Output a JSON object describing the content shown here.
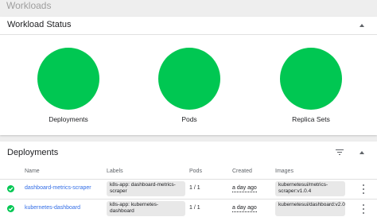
{
  "page": {
    "title": "Workloads"
  },
  "status_card": {
    "title": "Workload Status",
    "charts": [
      {
        "label": "Deployments",
        "color": "#00c752"
      },
      {
        "label": "Pods",
        "color": "#00c752"
      },
      {
        "label": "Replica Sets",
        "color": "#00c752"
      }
    ]
  },
  "deployments": {
    "title": "Deployments",
    "columns": [
      "Name",
      "Labels",
      "Pods",
      "Created",
      "Images"
    ],
    "rows": [
      {
        "status": "running",
        "name": "dashboard-metrics-scraper",
        "labels": "k8s-app: dashboard-metrics-scraper",
        "pods": "1 / 1",
        "created": "a day ago",
        "images": "kubernetesui/metrics-scraper:v1.0.4"
      },
      {
        "status": "running",
        "name": "kubernetes-dashboard",
        "labels": "k8s-app: kubernetes-dashboard",
        "pods": "1 / 1",
        "created": "a day ago",
        "images": "kubernetesui/dashboard:v2.0.0"
      }
    ]
  },
  "colors": {
    "ok": "#00c752",
    "link": "#326de6"
  }
}
